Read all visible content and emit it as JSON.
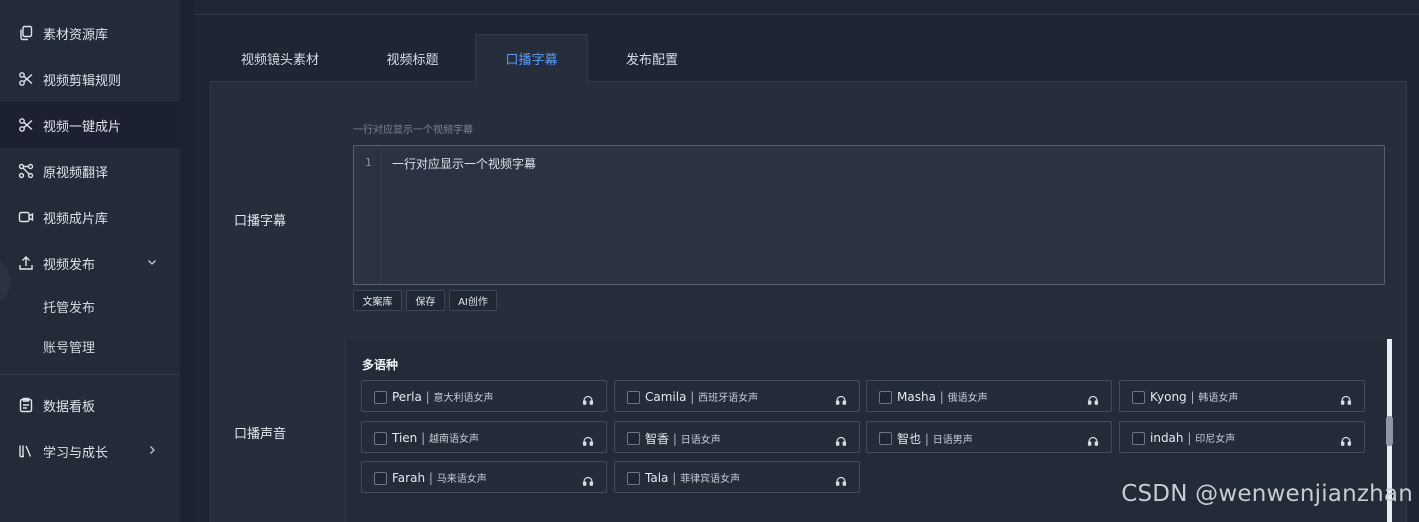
{
  "sidebar": {
    "items": [
      {
        "label": "素材资源库",
        "icon": "copy-icon"
      },
      {
        "label": "视频剪辑规则",
        "icon": "scissors-icon"
      },
      {
        "label": "视频一键成片",
        "icon": "scissors-icon"
      },
      {
        "label": "原视频翻译",
        "icon": "nodes-icon"
      },
      {
        "label": "视频成片库",
        "icon": "video-camera-icon"
      },
      {
        "label": "视频发布",
        "icon": "upload-icon"
      }
    ],
    "sub_items": [
      {
        "label": "托管发布"
      },
      {
        "label": "账号管理"
      }
    ],
    "bottom_items": [
      {
        "label": "数据看板",
        "icon": "clipboard-icon"
      },
      {
        "label": "学习与成长",
        "icon": "books-icon"
      }
    ]
  },
  "tabs": [
    {
      "label": "视频镜头素材"
    },
    {
      "label": "视频标题"
    },
    {
      "label": "口播字幕"
    },
    {
      "label": "发布配置"
    }
  ],
  "subtitle": {
    "label": "口播字幕",
    "hint": "一行对应显示一个视频字幕",
    "line_number": "1",
    "line_text": "一行对应显示一个视频字幕",
    "buttons": [
      "文案库",
      "保存",
      "AI创作"
    ]
  },
  "voice": {
    "label": "口播声音",
    "group_title": "多语种",
    "options": [
      {
        "name": "Perla",
        "desc": "意大利语女声"
      },
      {
        "name": "Camila",
        "desc": "西班牙语女声"
      },
      {
        "name": "Masha",
        "desc": "俄语女声"
      },
      {
        "name": "Kyong",
        "desc": "韩语女声"
      },
      {
        "name": "Tien",
        "desc": "越南语女声"
      },
      {
        "name": "智香",
        "desc": "日语女声"
      },
      {
        "name": "智也",
        "desc": "日语男声"
      },
      {
        "name": "indah",
        "desc": "印尼女声"
      },
      {
        "name": "Farah",
        "desc": "马来语女声"
      },
      {
        "name": "Tala",
        "desc": "菲律宾语女声"
      }
    ]
  },
  "separator": "|",
  "watermark": "CSDN @wenwenjianzhan",
  "colors": {
    "accent": "#5b9bf3",
    "background": "#1e2533"
  }
}
